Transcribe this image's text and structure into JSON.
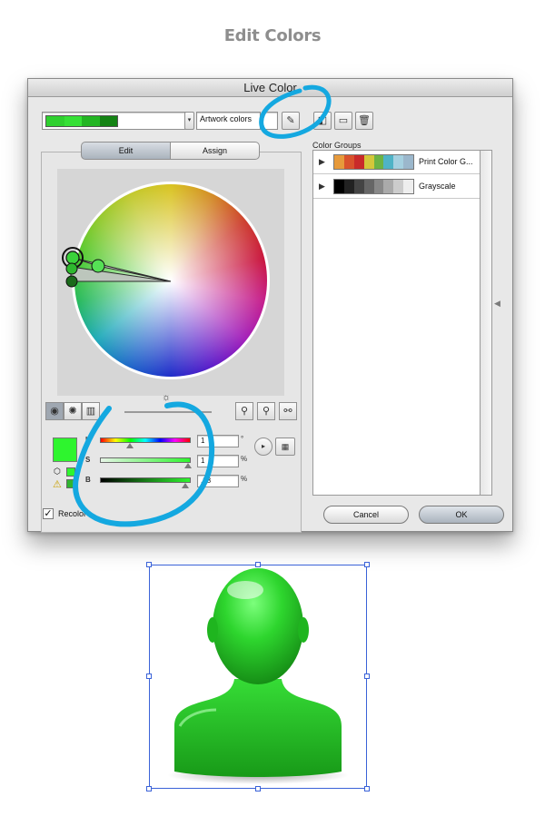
{
  "page": {
    "heading": "Edit Colors"
  },
  "dialog": {
    "title": "Live Color",
    "artwork_colors_field": {
      "value": "Artwork colors"
    },
    "artwork_swatches": [
      "#2fd02f",
      "#36e036",
      "#23b523",
      "#148314"
    ],
    "tabs": [
      {
        "label": "Edit",
        "selected": true
      },
      {
        "label": "Assign",
        "selected": false
      }
    ],
    "color_groups": {
      "label": "Color Groups",
      "items": [
        {
          "name": "Print Color G...",
          "swatches": [
            "#e79a3b",
            "#d9522c",
            "#c92a2a",
            "#d4c73a",
            "#6cb344",
            "#4fb3c6",
            "#a5d0e0",
            "#9bb7cc"
          ]
        },
        {
          "name": "Grayscale",
          "swatches": [
            "#000000",
            "#222222",
            "#444444",
            "#666666",
            "#888888",
            "#aaaaaa",
            "#cccccc",
            "#eeeeee"
          ]
        }
      ]
    },
    "hsb": {
      "h_label": "H",
      "h_value": "1",
      "h_unit": "°",
      "s_label": "S",
      "s_value": "1",
      "s_unit": "%",
      "b_label": "B",
      "b_value": ".08",
      "b_unit": "%"
    },
    "current_color": "#2ef52e",
    "recolor_label": "Recolor",
    "buttons": {
      "cancel": "Cancel",
      "ok": "OK"
    }
  },
  "colors": {
    "accent_annotation": "#14a8e0",
    "selection_frame": "#3a62d8",
    "figure_green": "#2ecc2e"
  }
}
